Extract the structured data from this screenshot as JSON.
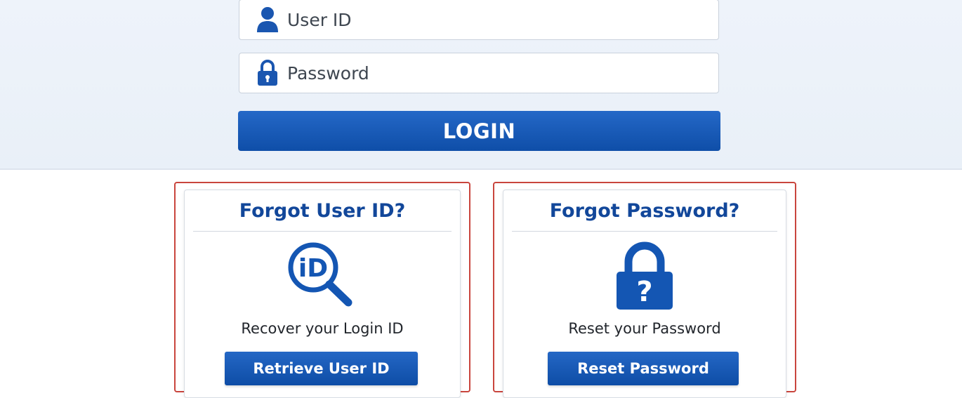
{
  "login_form": {
    "user_id_placeholder": "User ID",
    "password_placeholder": "Password",
    "login_button": "LOGIN"
  },
  "forgot_user_id": {
    "title": "Forgot User ID?",
    "icon": "id-search-icon",
    "description": "Recover your Login ID",
    "button": "Retrieve User ID"
  },
  "forgot_password": {
    "title": "Forgot Password?",
    "icon": "padlock-question-icon",
    "description": "Reset your Password",
    "button": "Reset Password"
  },
  "colors": {
    "primary_blue": "#1456b3",
    "title_blue": "#12479a",
    "highlight_red": "#c9453d",
    "band_background": "#eef3fa"
  }
}
